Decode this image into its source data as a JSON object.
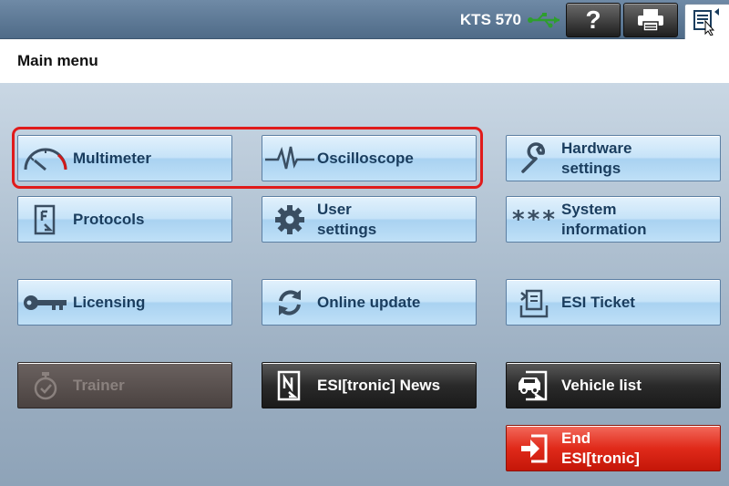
{
  "header": {
    "device_name": "KTS 570",
    "help_label": "?"
  },
  "page_title": "Main menu",
  "buttons": {
    "multimeter": "Multimeter",
    "oscilloscope": "Oscilloscope",
    "hardware_settings_1": "Hardware",
    "hardware_settings_2": "settings",
    "protocols": "Protocols",
    "user_settings_1": "User",
    "user_settings_2": "settings",
    "system_info_1": "System",
    "system_info_2": "information",
    "system_info_icon_text": "***",
    "licensing": "Licensing",
    "online_update": "Online update",
    "esi_ticket": "ESI Ticket",
    "trainer": "Trainer",
    "esi_news": "ESI[tronic] News",
    "vehicle_list": "Vehicle list",
    "end_1": "End",
    "end_2": "ESI[tronic]"
  },
  "colors": {
    "highlight": "#e01b1b",
    "usb": "#2e9e2e",
    "button_text": "#1a3d5e",
    "end_button": "#e02a1a"
  }
}
